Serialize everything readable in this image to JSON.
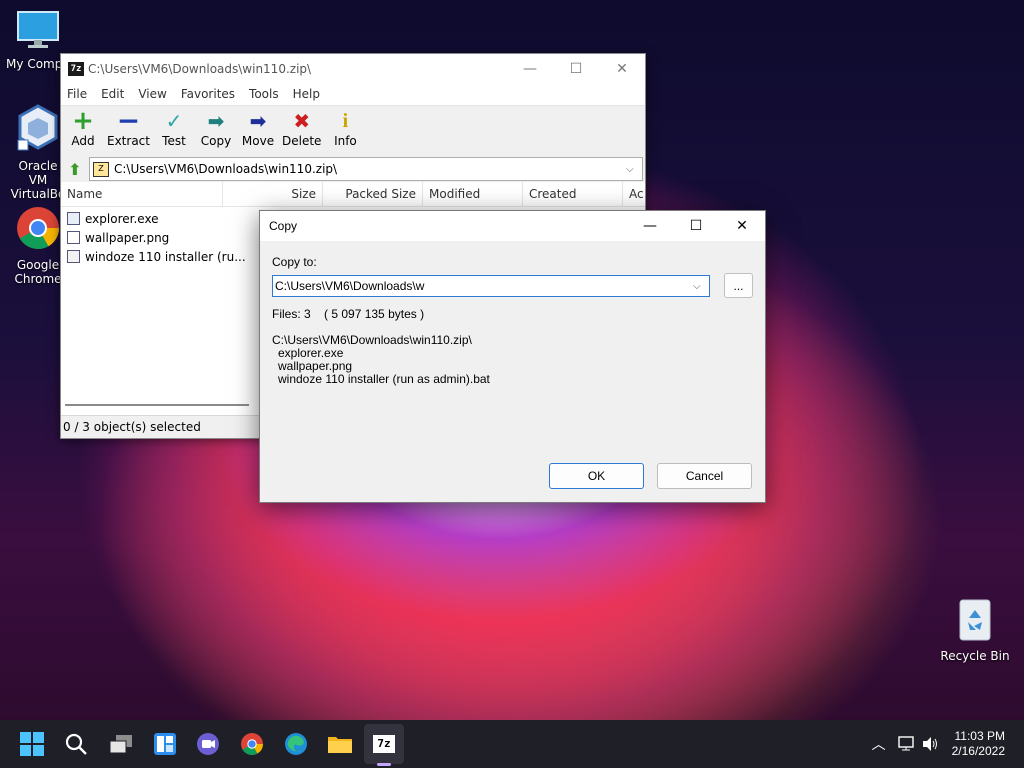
{
  "desktop": {
    "icons": [
      {
        "label": "My Compu"
      },
      {
        "label": "Oracle VM VirtualBo"
      },
      {
        "label": "Google Chrome"
      },
      {
        "label": "Recycle Bin"
      }
    ]
  },
  "window_7z": {
    "title": "C:\\Users\\VM6\\Downloads\\win110.zip\\",
    "app_icon_text": "7z",
    "menu": [
      "File",
      "Edit",
      "View",
      "Favorites",
      "Tools",
      "Help"
    ],
    "toolbar": [
      {
        "label": "Add",
        "icon": "+",
        "color": "#2e9e2e"
      },
      {
        "label": "Extract",
        "icon": "−",
        "color": "#1f3fb0"
      },
      {
        "label": "Test",
        "icon": "✓",
        "color": "#2aa6a6"
      },
      {
        "label": "Copy",
        "icon": "➡",
        "color": "#1f7f7f"
      },
      {
        "label": "Move",
        "icon": "➡",
        "color": "#1f2f9a"
      },
      {
        "label": "Delete",
        "icon": "✖",
        "color": "#cc1f1f"
      },
      {
        "label": "Info",
        "icon": "i",
        "color": "#c8a600"
      }
    ],
    "address": "C:\\Users\\VM6\\Downloads\\win110.zip\\",
    "columns": [
      "Name",
      "Size",
      "Packed Size",
      "Modified",
      "Created",
      "Ac"
    ],
    "files": [
      {
        "name": "explorer.exe"
      },
      {
        "name": "wallpaper.png"
      },
      {
        "name": "windoze 110 installer (ru..."
      }
    ],
    "status": "0 / 3 object(s) selected"
  },
  "copy_dialog": {
    "title": "Copy",
    "copy_to_label": "Copy to:",
    "path_value": "C:\\Users\\VM6\\Downloads\\w",
    "browse_label": "...",
    "files_summary": "Files: 3    ( 5 097 135 bytes )",
    "source_path": "C:\\Users\\VM6\\Downloads\\win110.zip\\",
    "file_list": [
      "explorer.exe",
      "wallpaper.png",
      "windoze 110 installer (run as admin).bat"
    ],
    "ok_label": "OK",
    "cancel_label": "Cancel"
  },
  "taskbar": {
    "app_7z_text": "7z",
    "time": "11:03 PM",
    "date": "2/16/2022"
  },
  "colors": {
    "accent": "#2a7bd6",
    "taskbar": "#1f1f27"
  }
}
